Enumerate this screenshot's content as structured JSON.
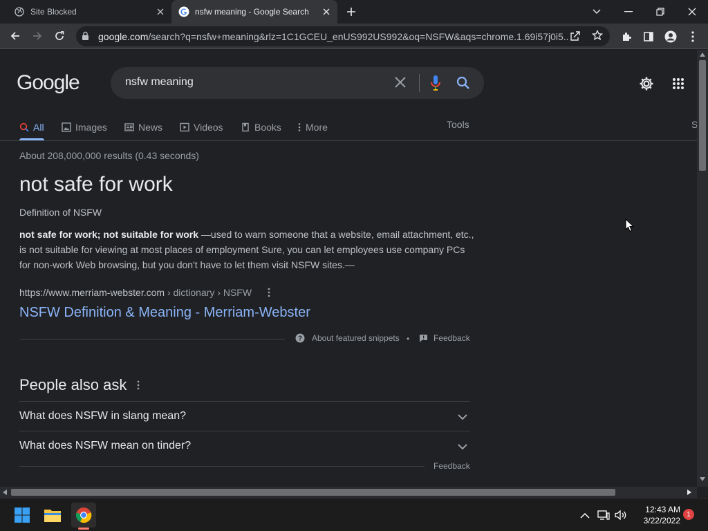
{
  "browser": {
    "tabs": [
      {
        "title": "Site Blocked",
        "active": false
      },
      {
        "title": "nsfw meaning - Google Search",
        "active": true
      }
    ],
    "url_host": "google.com",
    "url_rest": "/search?q=nsfw+meaning&rlz=1C1GCEU_enUS992US992&oq=NSFW&aqs=chrome.1.69i57j0i5..."
  },
  "search": {
    "logo": "Google",
    "query": "nsfw meaning",
    "tabs": [
      "All",
      "Images",
      "News",
      "Videos",
      "Books",
      "More"
    ],
    "tools_label": "Tools",
    "side_letter": "S",
    "stats": "About 208,000,000 results (0.43 seconds)"
  },
  "featured": {
    "answer": "not safe for work",
    "definition_label": "Definition of NSFW",
    "snippet_bold": "not safe for work; not suitable for work",
    "snippet_rest": " —used to warn someone that a website, email attachment, etc., is not suitable for viewing at most places of employment Sure, you can let employees use company PCs for non-work Web browsing, but you don't have to let them visit NSFW sites.—",
    "cite_url": "https://www.merriam-webster.com",
    "cite_path": " › dictionary › NSFW",
    "link_title": "NSFW Definition & Meaning - Merriam-Webster",
    "about_label": "About featured snippets",
    "separator": "•",
    "feedback_label": "Feedback"
  },
  "paa": {
    "title": "People also ask",
    "questions": [
      "What does NSFW in slang mean?",
      "What does NSFW mean on tinder?"
    ],
    "feedback_label": "Feedback"
  },
  "taskbar": {
    "time": "12:43 AM",
    "date": "3/22/2022",
    "notifications": "1"
  },
  "colors": {
    "accent": "#8ab4f8",
    "background": "#202124",
    "chrome_toolbar": "#35363a"
  }
}
